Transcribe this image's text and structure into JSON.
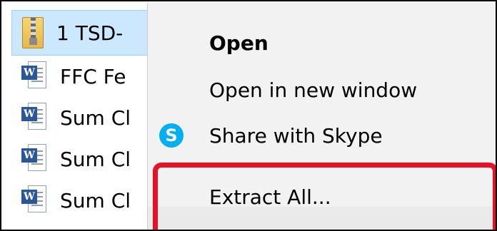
{
  "files": [
    {
      "name": "1 TSD-",
      "type": "zip",
      "selected": true
    },
    {
      "name": "FFC Fe",
      "type": "word",
      "selected": false
    },
    {
      "name": "Sum Cl",
      "type": "word",
      "selected": false
    },
    {
      "name": "Sum Cl",
      "type": "word",
      "selected": false
    },
    {
      "name": "Sum Cl",
      "type": "word",
      "selected": false
    }
  ],
  "menu": {
    "open": "Open",
    "open_new_window": "Open in new window",
    "share_skype": "Share with Skype",
    "skype_glyph": "S",
    "extract_all": "Extract All..."
  },
  "icons": {
    "word_badge": "W"
  },
  "colors": {
    "selection": "#cce8ff",
    "highlight": "#e81123",
    "skype": "#00aff0",
    "word": "#2b5797"
  }
}
